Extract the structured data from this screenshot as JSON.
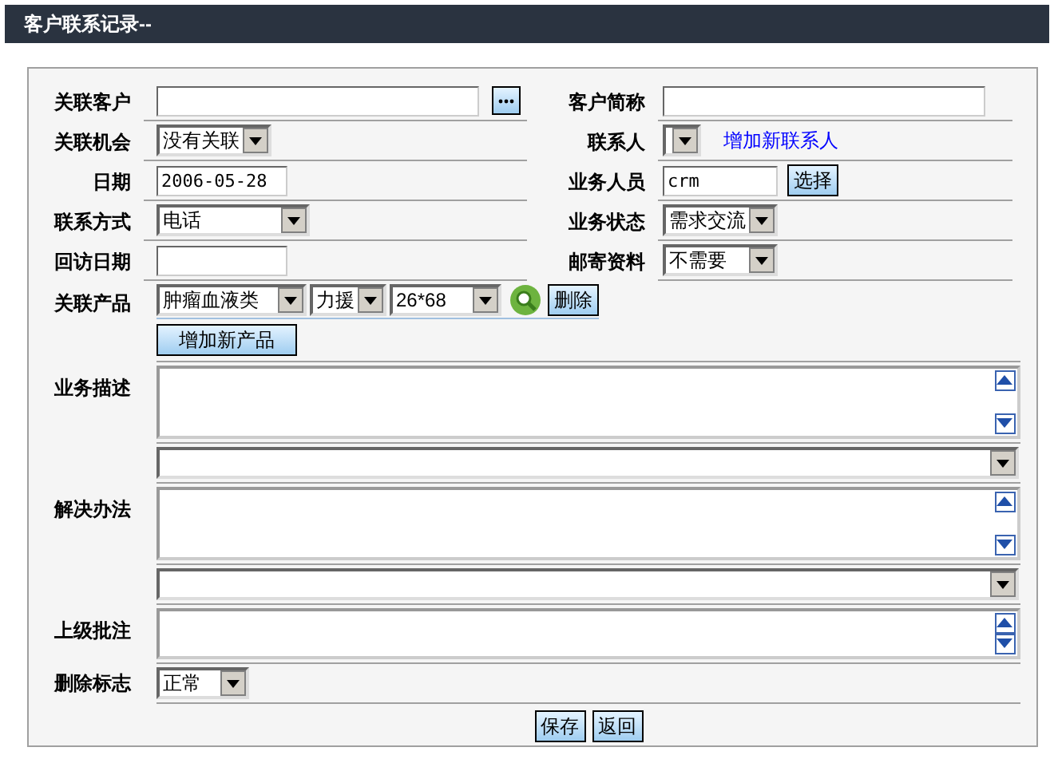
{
  "title": "客户联系记录--",
  "left_fields": [
    {
      "kind": "input_lookup",
      "label": "关联客户"
    },
    {
      "kind": "select",
      "label": "关联机会",
      "value": "没有关联"
    },
    {
      "kind": "input",
      "label": "日期",
      "value": "2006-05-28"
    },
    {
      "kind": "select",
      "label": "联系方式",
      "value": "电话"
    },
    {
      "kind": "input",
      "label": "回访日期"
    }
  ],
  "right_fields": [
    {
      "kind": "input",
      "label": "客户简称"
    },
    {
      "kind": "select_link",
      "label": "联系人",
      "link": "增加新联系人"
    },
    {
      "kind": "input_button",
      "label": "业务人员",
      "value": "crm",
      "button": "选择"
    },
    {
      "kind": "select",
      "label": "业务状态",
      "value": "需求交流"
    },
    {
      "kind": "select",
      "label": "邮寄资料",
      "value": "不需要"
    }
  ],
  "product": {
    "label": "关联产品",
    "selects": [
      "肿瘤血液类",
      "力援",
      "26*68"
    ],
    "delete_button": "删除",
    "add_button": "增加新产品"
  },
  "memo_rows": [
    {
      "kind": "textarea",
      "label": "业务描述"
    },
    {
      "kind": "combo"
    },
    {
      "kind": "textarea",
      "label": "解决办法"
    },
    {
      "kind": "combo"
    },
    {
      "kind": "textarea",
      "label": "上级批注"
    }
  ],
  "delete_flag": {
    "label": "删除标志",
    "value": "正常"
  },
  "buttons": [
    "保存",
    "返回"
  ]
}
